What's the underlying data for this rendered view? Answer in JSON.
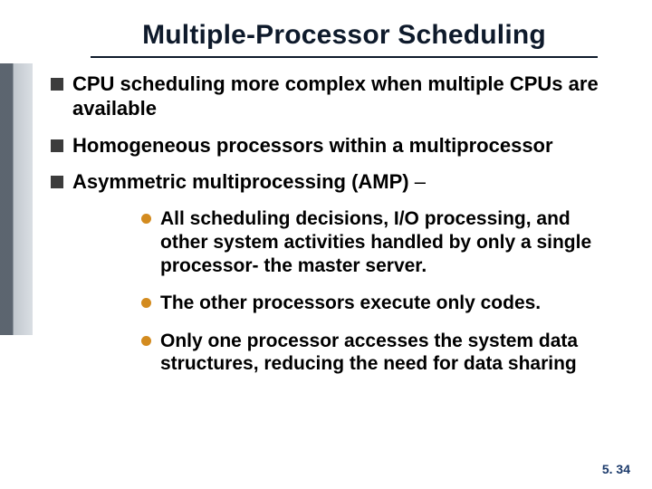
{
  "title": "Multiple-Processor Scheduling",
  "bullets": [
    {
      "text": "CPU scheduling more complex when multiple CPUs are available"
    },
    {
      "text": "Homogeneous processors within a multiprocessor"
    },
    {
      "text_bold": "Asymmetric multiprocessing (AMP)",
      "text_tail": " –"
    }
  ],
  "subbullets": [
    {
      "text": "All scheduling decisions, I/O processing, and other system activities handled by only a single processor- the master server."
    },
    {
      "text": "The other processors execute only codes."
    },
    {
      "text": "Only one processor accesses the system data structures, reducing the need for data sharing"
    }
  ],
  "page_number": "5. 34"
}
